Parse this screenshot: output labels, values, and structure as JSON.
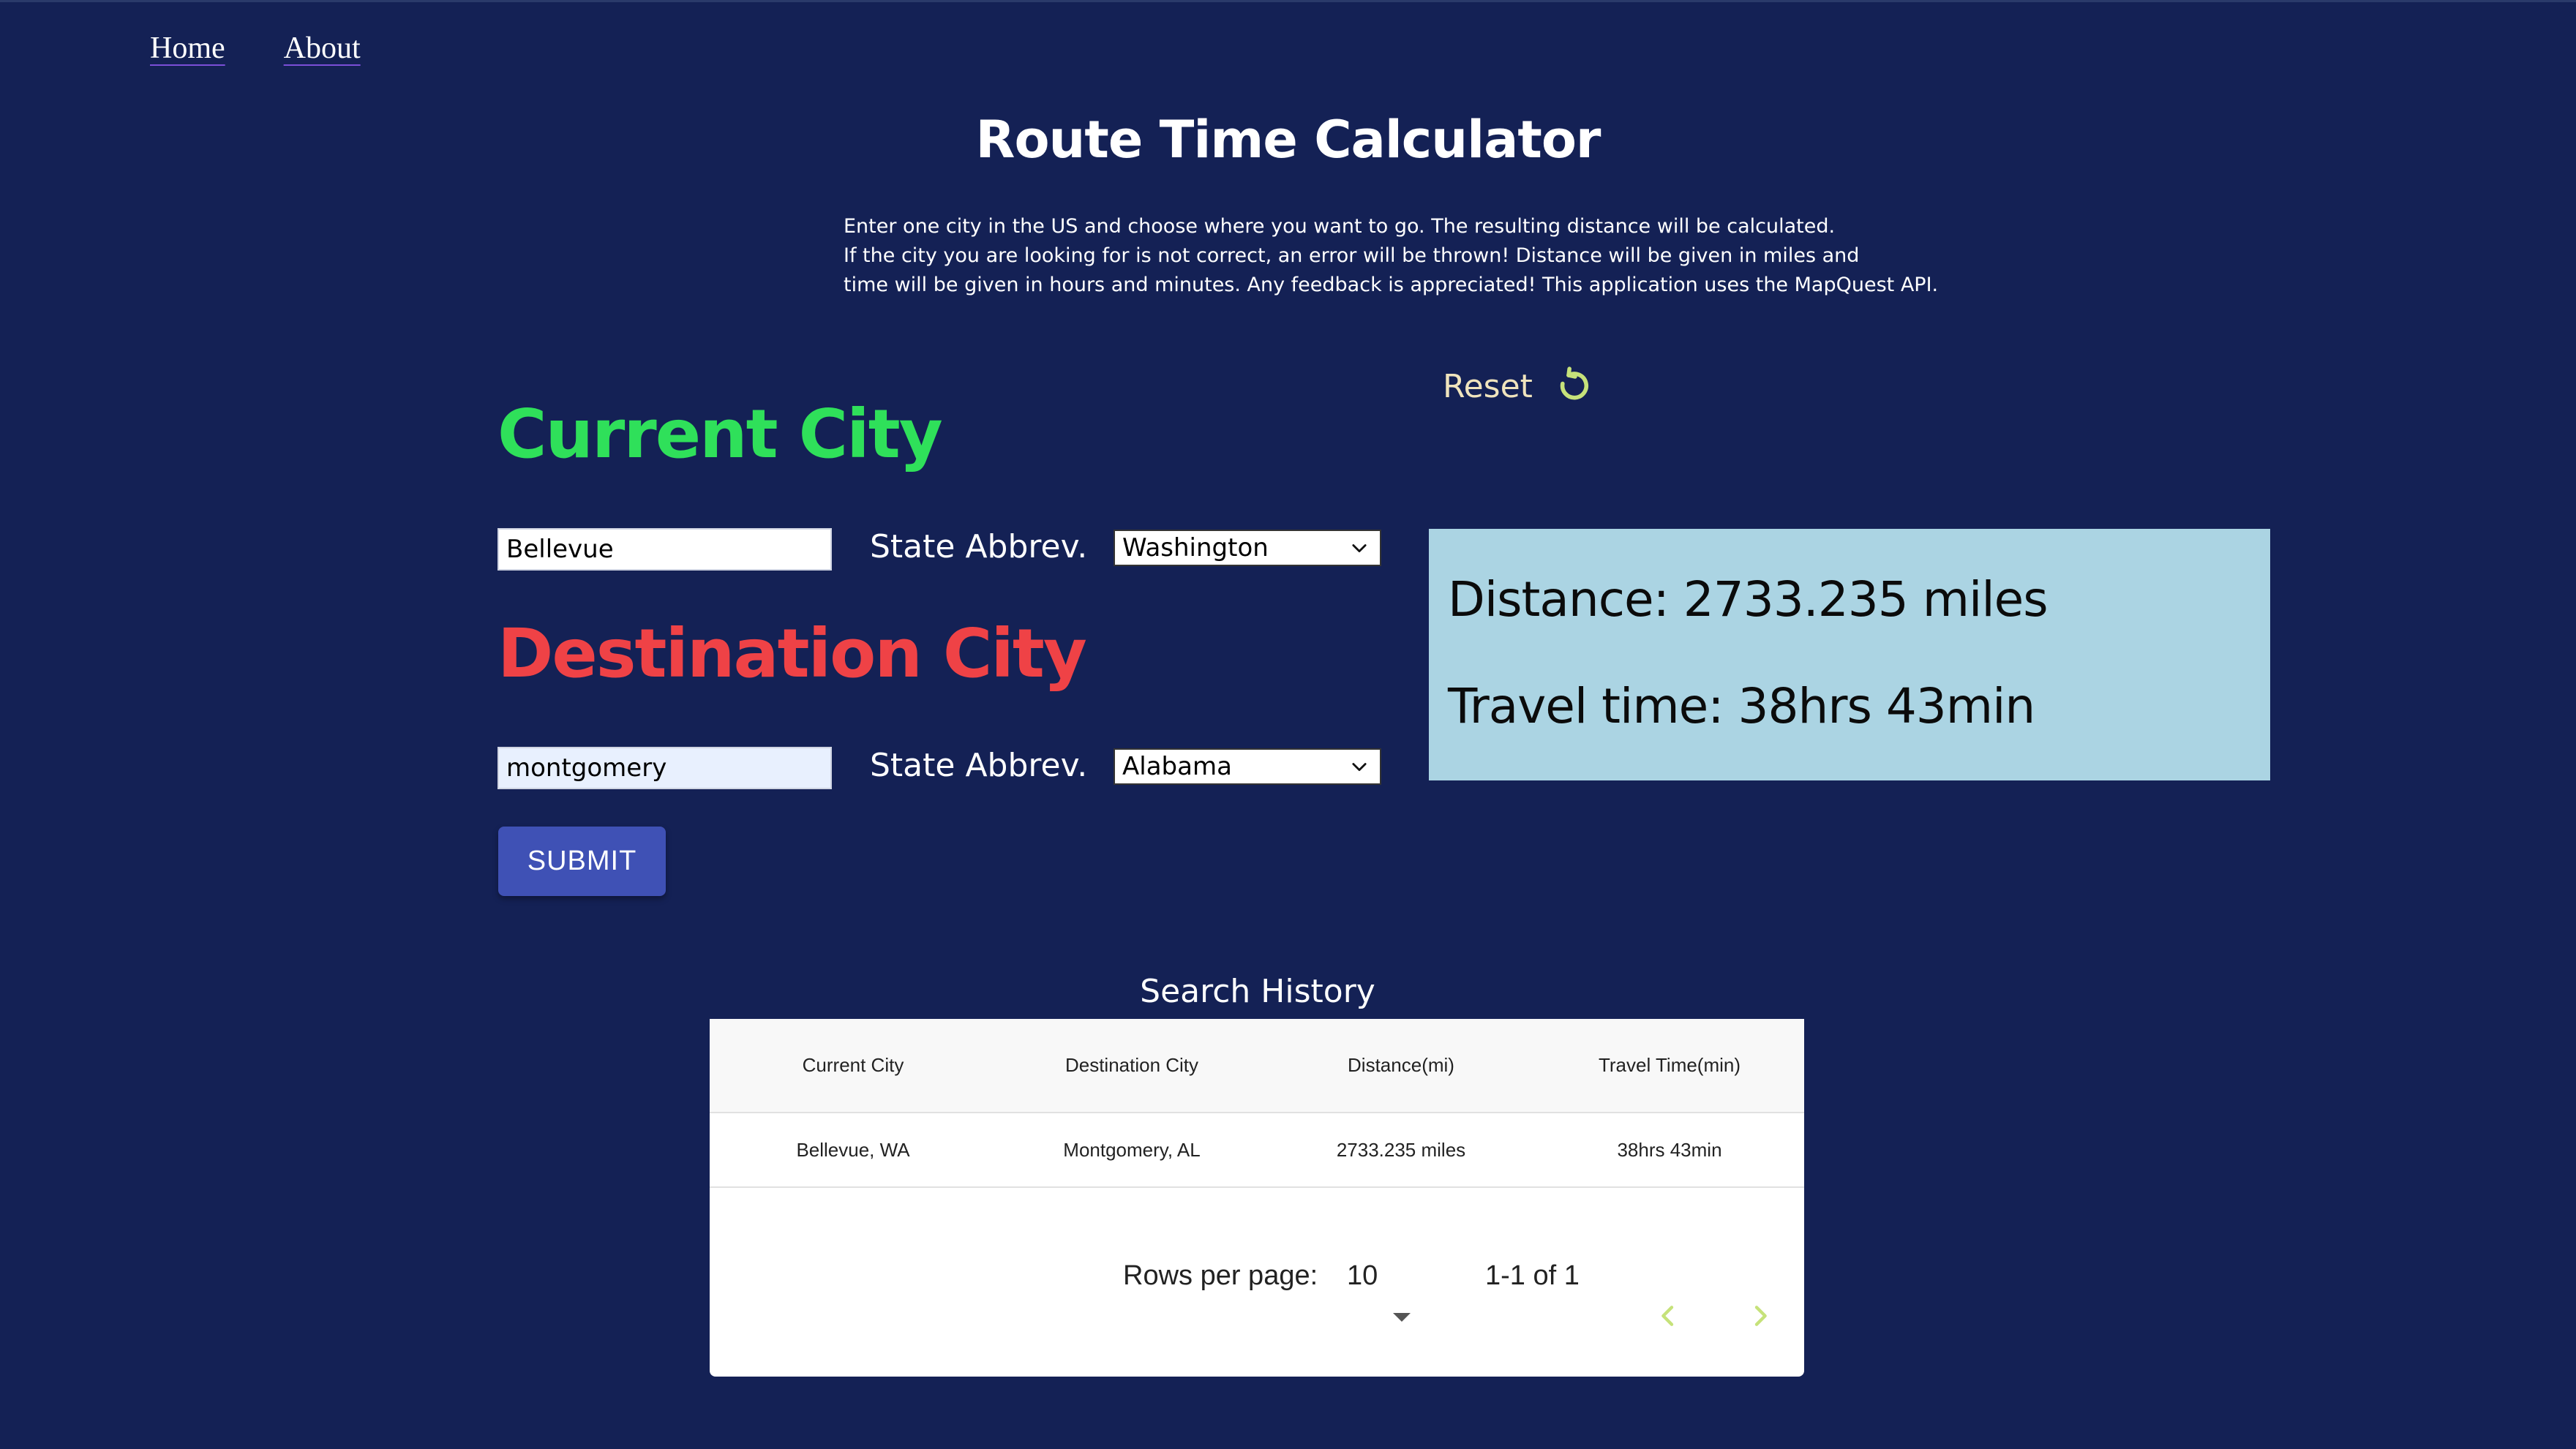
{
  "nav": {
    "home_label": "Home",
    "about_label": "About"
  },
  "header": {
    "title": "Route Time Calculator",
    "description_lines": [
      "Enter one city in the US and choose where you want to go. The resulting distance will be calculated.",
      "If the city you are looking for is not correct, an error will be thrown! Distance will be given in miles and",
      "time will be given in hours and minutes. Any feedback is appreciated! This application uses the MapQuest API."
    ]
  },
  "reset": {
    "label": "Reset",
    "icon": "refresh-icon"
  },
  "current": {
    "heading": "Current City",
    "city_value": "Bellevue",
    "state_label": "State Abbrev.",
    "state_value": "Washington"
  },
  "destination": {
    "heading": "Destination City",
    "city_value": "montgomery",
    "state_label": "State Abbrev.",
    "state_value": "Alabama"
  },
  "submit_label": "SUBMIT",
  "result": {
    "distance": "Distance: 2733.235 miles",
    "travel_time": "Travel time: 38hrs 43min"
  },
  "history": {
    "title": "Search History",
    "columns": [
      "Current City",
      "Destination City",
      "Distance(mi)",
      "Travel Time(min)"
    ],
    "rows": [
      [
        "Bellevue, WA",
        "Montgomery, AL",
        "2733.235 miles",
        "38hrs 43min"
      ]
    ],
    "pagination": {
      "rows_per_page_label": "Rows per page:",
      "rows_per_page_value": "10",
      "range": "1-1 of 1"
    }
  },
  "colors": {
    "background": "#142155",
    "current_heading": "#2fe05a",
    "destination_heading": "#ef4246",
    "result_box": "#abd4e3",
    "submit": "#3f51b5",
    "reset_text": "#f0e4bd",
    "pager_arrows": "#c6e27a"
  }
}
